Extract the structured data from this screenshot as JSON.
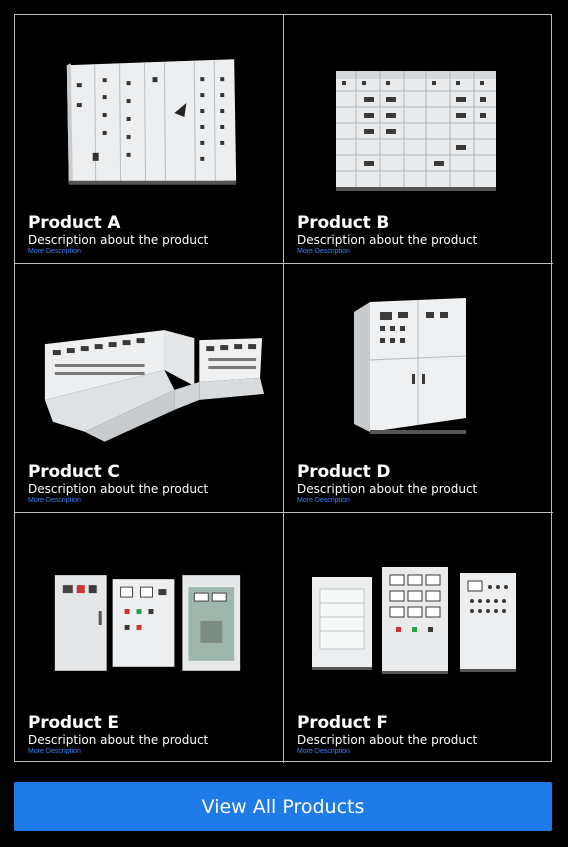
{
  "products": [
    {
      "title": "Product A",
      "description": "Description about the product",
      "more": "More Description",
      "icon": "switchgear-panel-image"
    },
    {
      "title": "Product B",
      "description": "Description about the product",
      "more": "More Description",
      "icon": "mcc-panel-image"
    },
    {
      "title": "Product C",
      "description": "Description about the product",
      "more": "More Description",
      "icon": "control-desk-image"
    },
    {
      "title": "Product D",
      "description": "Description about the product",
      "more": "More Description",
      "icon": "cabinet-panel-image"
    },
    {
      "title": "Product E",
      "description": "Description about the product",
      "more": "More Description",
      "icon": "distribution-boxes-image"
    },
    {
      "title": "Product F",
      "description": "Description about the product",
      "more": "More Description",
      "icon": "control-panels-image"
    }
  ],
  "cta": {
    "label": "View All Products"
  },
  "colors": {
    "background": "#000000",
    "accent": "#1e7be8",
    "link": "#3b82f6",
    "border": "#bdbdbd"
  }
}
